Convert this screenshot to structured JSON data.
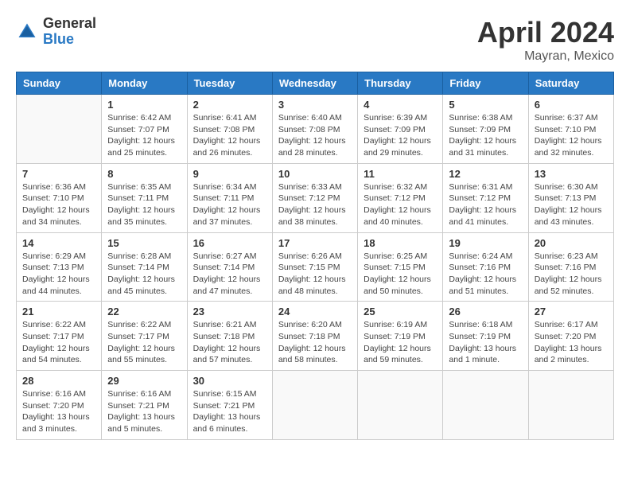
{
  "header": {
    "logo_general": "General",
    "logo_blue": "Blue",
    "month": "April 2024",
    "location": "Mayran, Mexico"
  },
  "days_of_week": [
    "Sunday",
    "Monday",
    "Tuesday",
    "Wednesday",
    "Thursday",
    "Friday",
    "Saturday"
  ],
  "weeks": [
    [
      {
        "num": "",
        "empty": true
      },
      {
        "num": "1",
        "sunrise": "6:42 AM",
        "sunset": "7:07 PM",
        "daylight": "12 hours and 25 minutes."
      },
      {
        "num": "2",
        "sunrise": "6:41 AM",
        "sunset": "7:08 PM",
        "daylight": "12 hours and 26 minutes."
      },
      {
        "num": "3",
        "sunrise": "6:40 AM",
        "sunset": "7:08 PM",
        "daylight": "12 hours and 28 minutes."
      },
      {
        "num": "4",
        "sunrise": "6:39 AM",
        "sunset": "7:09 PM",
        "daylight": "12 hours and 29 minutes."
      },
      {
        "num": "5",
        "sunrise": "6:38 AM",
        "sunset": "7:09 PM",
        "daylight": "12 hours and 31 minutes."
      },
      {
        "num": "6",
        "sunrise": "6:37 AM",
        "sunset": "7:10 PM",
        "daylight": "12 hours and 32 minutes."
      }
    ],
    [
      {
        "num": "7",
        "sunrise": "6:36 AM",
        "sunset": "7:10 PM",
        "daylight": "12 hours and 34 minutes."
      },
      {
        "num": "8",
        "sunrise": "6:35 AM",
        "sunset": "7:11 PM",
        "daylight": "12 hours and 35 minutes."
      },
      {
        "num": "9",
        "sunrise": "6:34 AM",
        "sunset": "7:11 PM",
        "daylight": "12 hours and 37 minutes."
      },
      {
        "num": "10",
        "sunrise": "6:33 AM",
        "sunset": "7:12 PM",
        "daylight": "12 hours and 38 minutes."
      },
      {
        "num": "11",
        "sunrise": "6:32 AM",
        "sunset": "7:12 PM",
        "daylight": "12 hours and 40 minutes."
      },
      {
        "num": "12",
        "sunrise": "6:31 AM",
        "sunset": "7:12 PM",
        "daylight": "12 hours and 41 minutes."
      },
      {
        "num": "13",
        "sunrise": "6:30 AM",
        "sunset": "7:13 PM",
        "daylight": "12 hours and 43 minutes."
      }
    ],
    [
      {
        "num": "14",
        "sunrise": "6:29 AM",
        "sunset": "7:13 PM",
        "daylight": "12 hours and 44 minutes."
      },
      {
        "num": "15",
        "sunrise": "6:28 AM",
        "sunset": "7:14 PM",
        "daylight": "12 hours and 45 minutes."
      },
      {
        "num": "16",
        "sunrise": "6:27 AM",
        "sunset": "7:14 PM",
        "daylight": "12 hours and 47 minutes."
      },
      {
        "num": "17",
        "sunrise": "6:26 AM",
        "sunset": "7:15 PM",
        "daylight": "12 hours and 48 minutes."
      },
      {
        "num": "18",
        "sunrise": "6:25 AM",
        "sunset": "7:15 PM",
        "daylight": "12 hours and 50 minutes."
      },
      {
        "num": "19",
        "sunrise": "6:24 AM",
        "sunset": "7:16 PM",
        "daylight": "12 hours and 51 minutes."
      },
      {
        "num": "20",
        "sunrise": "6:23 AM",
        "sunset": "7:16 PM",
        "daylight": "12 hours and 52 minutes."
      }
    ],
    [
      {
        "num": "21",
        "sunrise": "6:22 AM",
        "sunset": "7:17 PM",
        "daylight": "12 hours and 54 minutes."
      },
      {
        "num": "22",
        "sunrise": "6:22 AM",
        "sunset": "7:17 PM",
        "daylight": "12 hours and 55 minutes."
      },
      {
        "num": "23",
        "sunrise": "6:21 AM",
        "sunset": "7:18 PM",
        "daylight": "12 hours and 57 minutes."
      },
      {
        "num": "24",
        "sunrise": "6:20 AM",
        "sunset": "7:18 PM",
        "daylight": "12 hours and 58 minutes."
      },
      {
        "num": "25",
        "sunrise": "6:19 AM",
        "sunset": "7:19 PM",
        "daylight": "12 hours and 59 minutes."
      },
      {
        "num": "26",
        "sunrise": "6:18 AM",
        "sunset": "7:19 PM",
        "daylight": "13 hours and 1 minute."
      },
      {
        "num": "27",
        "sunrise": "6:17 AM",
        "sunset": "7:20 PM",
        "daylight": "13 hours and 2 minutes."
      }
    ],
    [
      {
        "num": "28",
        "sunrise": "6:16 AM",
        "sunset": "7:20 PM",
        "daylight": "13 hours and 3 minutes."
      },
      {
        "num": "29",
        "sunrise": "6:16 AM",
        "sunset": "7:21 PM",
        "daylight": "13 hours and 5 minutes."
      },
      {
        "num": "30",
        "sunrise": "6:15 AM",
        "sunset": "7:21 PM",
        "daylight": "13 hours and 6 minutes."
      },
      {
        "num": "",
        "empty": true
      },
      {
        "num": "",
        "empty": true
      },
      {
        "num": "",
        "empty": true
      },
      {
        "num": "",
        "empty": true
      }
    ]
  ]
}
